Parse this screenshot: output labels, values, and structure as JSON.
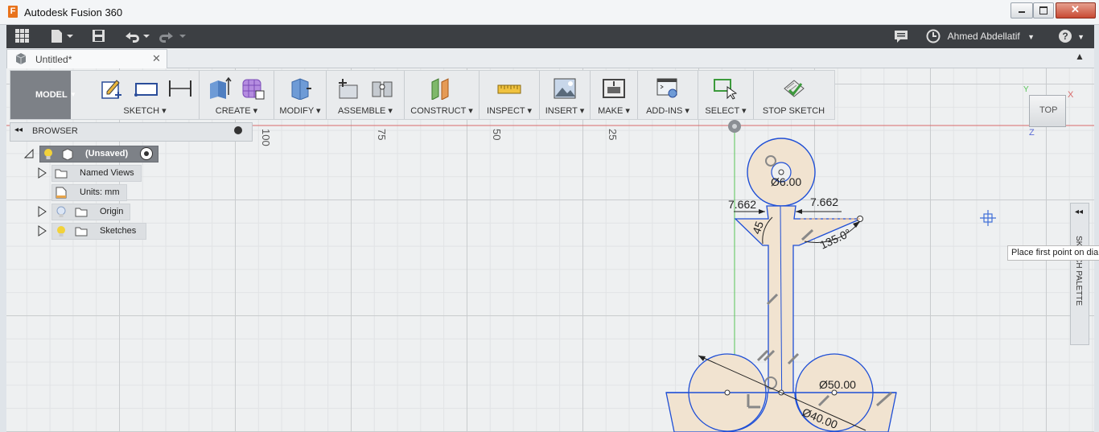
{
  "window": {
    "title": "Autodesk Fusion 360",
    "logo_letter": "F"
  },
  "topbar": {
    "user_name": "Ahmed Abdellatif",
    "help_label": "?"
  },
  "tab": {
    "title": "Untitled*"
  },
  "toolbar": {
    "mode": "MODEL",
    "groups": [
      "SKETCH",
      "CREATE",
      "MODIFY",
      "ASSEMBLE",
      "CONSTRUCT",
      "INSPECT",
      "INSERT",
      "MAKE",
      "ADD-INS",
      "SELECT",
      "STOP SKETCH"
    ]
  },
  "browser": {
    "header": "BROWSER",
    "root": "(Unsaved)",
    "items": [
      "Named Views",
      "Units: mm",
      "Origin",
      "Sketches"
    ]
  },
  "ruler": {
    "ticks": [
      "100",
      "75",
      "50",
      "25"
    ]
  },
  "viewcube": {
    "face": "TOP",
    "axes": {
      "x": "X",
      "y": "Y",
      "z": "Z"
    }
  },
  "palette": {
    "label": "SKETCH PALETTE"
  },
  "tooltip": {
    "text": "Place first point on diameter"
  },
  "dimensions": {
    "hole_diameter": "Ø6.00",
    "left_width": "7.662",
    "right_width": "7.662",
    "left_angle": "45",
    "right_angle": "135.0°",
    "circle_diameter": "Ø50.00",
    "base_diameter": "Ø40.00"
  },
  "colors": {
    "accent": "#1f4fd6",
    "sketch_fill": "#f1e3d0",
    "axis_red": "#d86a6a",
    "axis_green": "#58c458"
  }
}
